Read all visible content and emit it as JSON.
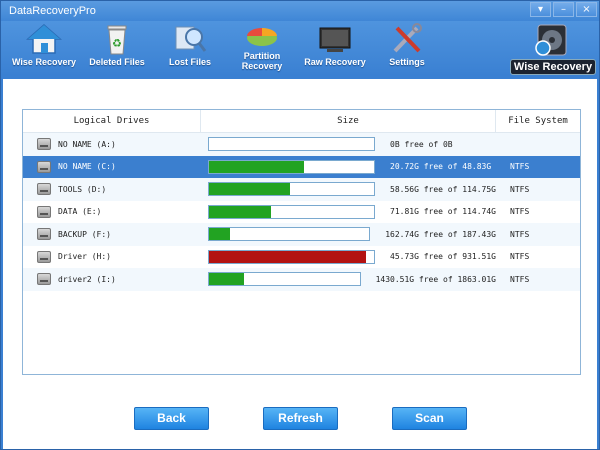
{
  "window": {
    "title": "DataRecoveryPro"
  },
  "toolbar": {
    "items": [
      {
        "label": "Wise Recovery",
        "icon": "house-icon"
      },
      {
        "label": "Deleted Files",
        "icon": "recycle-bin-icon"
      },
      {
        "label": "Lost Files",
        "icon": "magnifier-icon"
      },
      {
        "label": "Partition Recovery",
        "icon": "pie-chart-icon"
      },
      {
        "label": "Raw Recovery",
        "icon": "monitor-icon"
      },
      {
        "label": "Settings",
        "icon": "tools-icon"
      }
    ],
    "partition_label_line1": "Partition",
    "partition_label_line2": "Recovery"
  },
  "brand": {
    "text": "Wise Recovery"
  },
  "table": {
    "headers": {
      "drives": "Logical Drives",
      "size": "Size",
      "fs": "File System"
    },
    "rows": [
      {
        "name": "NO NAME (A:)",
        "free": "0B free of 0B",
        "fs": "",
        "used_fraction": 0,
        "bar_color": "#22a322",
        "selected": false
      },
      {
        "name": "NO NAME (C:)",
        "free": "20.72G free of 48.83G",
        "fs": "NTFS",
        "used_fraction": 0.576,
        "bar_color": "#22a322",
        "selected": true
      },
      {
        "name": "TOOLS (D:)",
        "free": "58.56G free of 114.75G",
        "fs": "NTFS",
        "used_fraction": 0.49,
        "bar_color": "#22a322",
        "selected": false
      },
      {
        "name": "DATA (E:)",
        "free": "71.81G free of 114.74G",
        "fs": "NTFS",
        "used_fraction": 0.374,
        "bar_color": "#22a322",
        "selected": false
      },
      {
        "name": "BACKUP (F:)",
        "free": "162.74G free of 187.43G",
        "fs": "NTFS",
        "used_fraction": 0.132,
        "bar_color": "#22a322",
        "selected": false
      },
      {
        "name": "Driver (H:)",
        "free": "45.73G free of 931.51G",
        "fs": "NTFS",
        "used_fraction": 0.951,
        "bar_color": "#b31212",
        "selected": false
      },
      {
        "name": "driver2 (I:)",
        "free": "1430.51G free of 1863.01G",
        "fs": "NTFS",
        "used_fraction": 0.232,
        "bar_color": "#22a322",
        "selected": false
      }
    ]
  },
  "buttons": {
    "back": "Back",
    "refresh": "Refresh",
    "scan": "Scan"
  },
  "colors": {
    "accent": "#3a80d2",
    "selection": "#3b7fcf",
    "button": "#2b8ee6"
  }
}
